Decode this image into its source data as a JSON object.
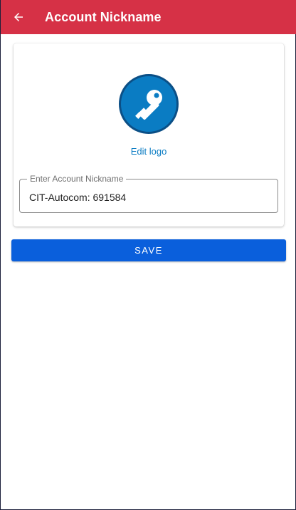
{
  "appbar": {
    "title": "Account Nickname",
    "back_icon": "arrow-left-icon",
    "background_color": "#d63146"
  },
  "card": {
    "logo_icon": "key-icon",
    "logo_color": "#0a7cc3",
    "edit_logo_label": "Edit logo",
    "nickname_field": {
      "label": "Enter Account Nickname",
      "value": "CIT-Autocom: 691584"
    }
  },
  "actions": {
    "save_label": "SAVE",
    "save_color": "#0a5fdc"
  }
}
